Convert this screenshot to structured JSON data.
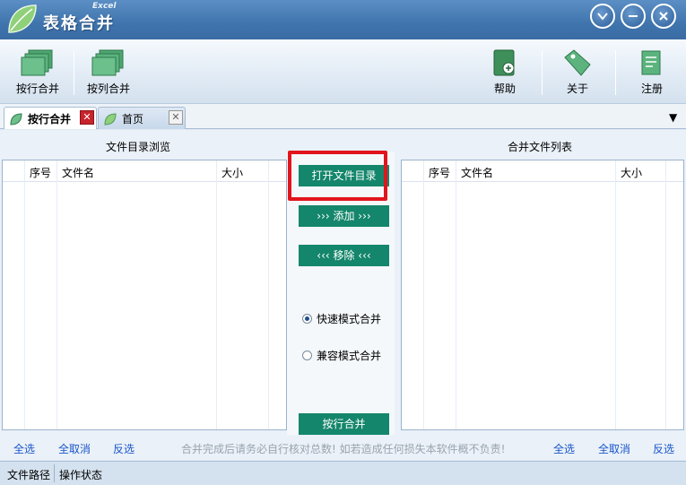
{
  "app": {
    "title": "表格合并",
    "subtitle": "Excel"
  },
  "toolbar": {
    "row_merge": "按行合并",
    "col_merge": "按列合并",
    "help": "帮助",
    "about": "关于",
    "register": "注册"
  },
  "tabs": [
    {
      "label": "按行合并",
      "active": true
    },
    {
      "label": "首页",
      "active": false
    }
  ],
  "left_panel": {
    "title": "文件目录浏览",
    "columns": [
      "序号",
      "文件名",
      "大小"
    ]
  },
  "right_panel": {
    "title": "合并文件列表",
    "columns": [
      "序号",
      "文件名",
      "大小"
    ]
  },
  "actions": {
    "open_dir": "打开文件目录",
    "add": "››› 添加 ›››",
    "remove": "‹‹‹ 移除 ‹‹‹",
    "merge": "按行合并"
  },
  "modes": {
    "fast": "快速模式合并",
    "compat": "兼容模式合并",
    "selected": "fast"
  },
  "bottom": {
    "select_all": "全选",
    "deselect_all": "全取消",
    "invert": "反选",
    "notice": "合并完成后请务必自行核对总数! 如若造成任何损失本软件概不负责!"
  },
  "status": {
    "path": "文件路径",
    "state": "操作状态"
  },
  "colors": {
    "accent_green": "#14866b",
    "highlight_red": "#e2141c",
    "title_blue": "#3f74ad"
  }
}
